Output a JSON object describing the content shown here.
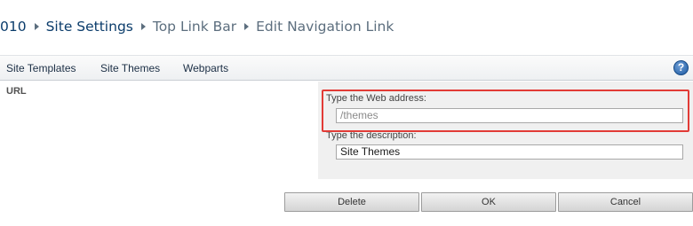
{
  "breadcrumb": {
    "items": [
      "010",
      "Site Settings",
      "Top Link Bar",
      "Edit Navigation Link"
    ]
  },
  "topnav": {
    "items": [
      "Site Templates",
      "Site Themes",
      "Webparts"
    ],
    "help_icon": "help-icon",
    "help_glyph": "?"
  },
  "form": {
    "field_label": "URL",
    "web_address_caption": "Type the Web address:",
    "web_address_value": "/themes",
    "description_caption": "Type the description:",
    "description_value": "Site Themes"
  },
  "buttons": {
    "delete": "Delete",
    "ok": "OK",
    "cancel": "Cancel"
  },
  "colors": {
    "breadcrumb_link": "#0b3c6b",
    "highlight": "#e23b36",
    "help_icon": "#1d5aa3"
  }
}
